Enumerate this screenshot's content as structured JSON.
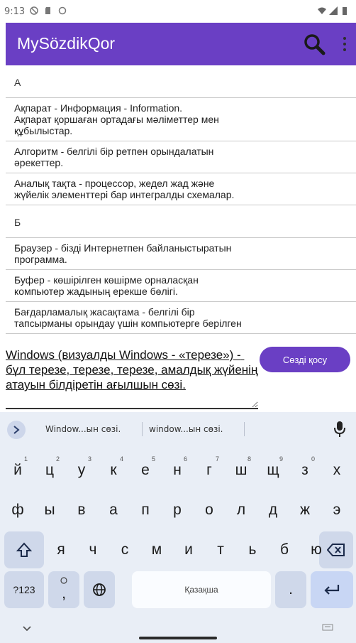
{
  "status_bar": {
    "time": "9:13"
  },
  "app_bar": {
    "title": "MySözdikQor"
  },
  "list": {
    "sections": [
      {
        "header": "А",
        "items": [
          {
            "line1": "Ақпарат - Информация - Information.",
            "line2": "Ақпарат қоршаған ортадағы мәліметтер мен",
            "line3": "құбылыстар."
          },
          {
            "line1": "Алгоритм - белгілі бір ретпен орындалатын",
            "line2": "әрекеттер."
          },
          {
            "line1": "Аналық тақта - процессор, жедел жад және",
            "line2": "жүйелік элементтері бар интегралды схемалар."
          }
        ]
      },
      {
        "header": "Б",
        "items": [
          {
            "line1": "Браузер - бізді Интернетпен байланыстыратын",
            "line2": "программа."
          },
          {
            "line1": "Буфер - көшірілген көшірме орналасқан",
            "line2": "компьютер жадының ерекше бөлігі."
          },
          {
            "line1": "Бағдарламалық жасақтама - белгілі бір",
            "line2": "тапсырманы орындау үшін компьютерге берілген"
          }
        ]
      }
    ]
  },
  "entry": {
    "value": "Windows (визуалды Windows - «терезе») - бұл терезе, терезе, терезе, амалдық жүйенің атауын білдіретін ағылшын сөзі.",
    "add_button": "Сөзді қосу"
  },
  "keyboard": {
    "suggestions": [
      "Window...ын сөзі.",
      "window...ын сөзі."
    ],
    "row1": [
      {
        "k": "й",
        "h": "1"
      },
      {
        "k": "ц",
        "h": "2"
      },
      {
        "k": "у",
        "h": "3"
      },
      {
        "k": "к",
        "h": "4"
      },
      {
        "k": "е",
        "h": "5"
      },
      {
        "k": "н",
        "h": "6"
      },
      {
        "k": "г",
        "h": "7"
      },
      {
        "k": "ш",
        "h": "8"
      },
      {
        "k": "щ",
        "h": "9"
      },
      {
        "k": "з",
        "h": "0"
      },
      {
        "k": "х",
        "h": ""
      }
    ],
    "row2": [
      "ф",
      "ы",
      "в",
      "а",
      "п",
      "р",
      "о",
      "л",
      "д",
      "ж",
      "э"
    ],
    "row3": [
      "я",
      "ч",
      "с",
      "м",
      "и",
      "т",
      "ь",
      "б",
      "ю"
    ],
    "symbols_key": "?123",
    "comma_key": ",",
    "space_label": "Қазақша",
    "period_key": "."
  }
}
